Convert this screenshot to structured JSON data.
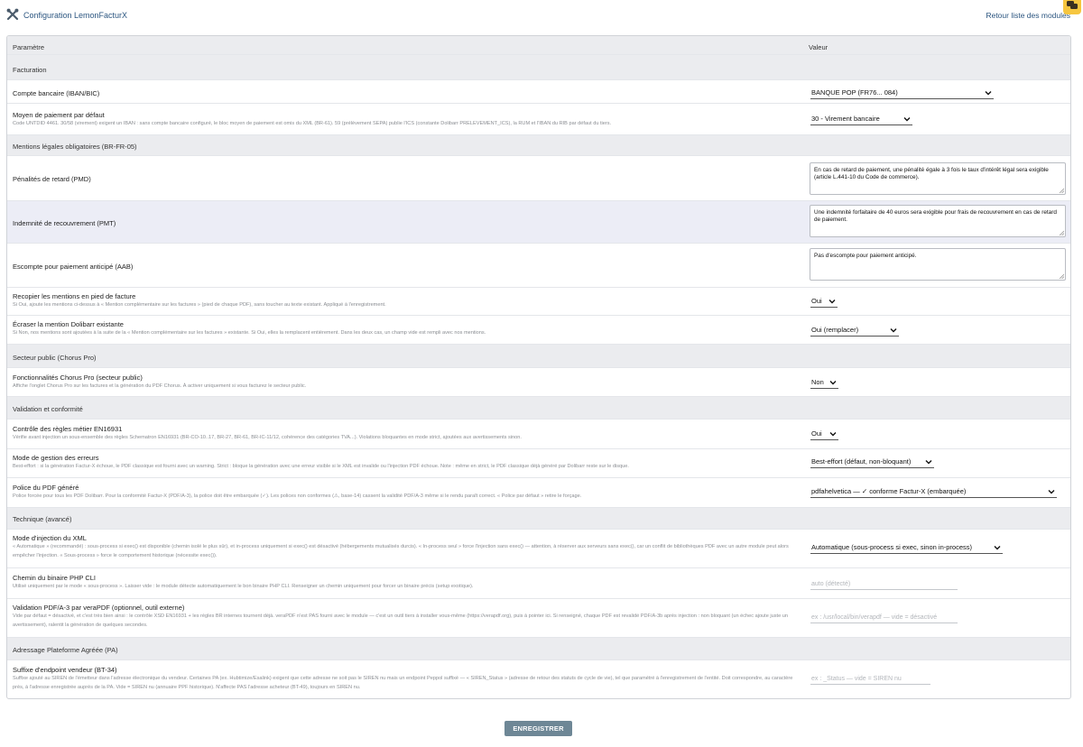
{
  "header": {
    "title": "Configuration LemonFacturX",
    "back_link": "Retour liste des modules",
    "title_icon": "tools-icon",
    "corner_icon": "chat-icon"
  },
  "table": {
    "col_param": "Paramètre",
    "col_value": "Valeur"
  },
  "sections": {
    "facturation": "Facturation",
    "mentions": "Mentions légales obligatoires (BR-FR-05)",
    "chorus": "Secteur public (Chorus Pro)",
    "validation": "Validation et conformité",
    "technique": "Technique (avancé)",
    "pa": "Adressage Plateforme Agréée (PA)"
  },
  "fields": {
    "bank": {
      "label": "Compte bancaire (IBAN/BIC)",
      "value": "BANQUE POP (FR76... 084)"
    },
    "payment": {
      "label": "Moyen de paiement par défaut",
      "desc": "Code UNTDID 4461. 30/58 (virement) exigent un IBAN : sans compte bancaire configuré, le bloc moyen de paiement est omis du XML (BR-61). 59 (prélèvement SEPA) publie l'ICS (constante Dolibarr PRELEVEMENT_ICS), la RUM et l'IBAN du RIB par défaut du tiers.",
      "value": "30 - Virement bancaire"
    },
    "pmd": {
      "label": "Pénalités de retard (PMD)",
      "value": "En cas de retard de paiement, une pénalité égale à 3 fois le taux d'intérêt légal sera exigible (article L.441-10 du Code de commerce)."
    },
    "pmt": {
      "label": "Indemnité de recouvrement (PMT)",
      "value": "Une indemnité forfaitaire de 40 euros sera exigible pour frais de recouvrement en cas de retard de paiement."
    },
    "aab": {
      "label": "Escompte pour paiement anticipé (AAB)",
      "value": "Pas d'escompte pour paiement anticipé."
    },
    "copy_mentions": {
      "label": "Recopier les mentions en pied de facture",
      "desc": "Si Oui, ajoute les mentions ci-dessus à « Mention complémentaire sur les factures » (pied de chaque PDF), sans toucher au texte existant. Appliqué à l'enregistrement.",
      "value": "Oui"
    },
    "overwrite": {
      "label": "Écraser la mention Dolibarr existante",
      "desc": "Si Non, nos mentions sont ajoutées à la suite de la « Mention complémentaire sur les factures » existante. Si Oui, elles la remplacent entièrement. Dans les deux cas, un champ vide est rempli avec nos mentions.",
      "value": "Oui (remplacer)"
    },
    "chorus": {
      "label": "Fonctionnalités Chorus Pro (secteur public)",
      "desc": "Affiche l'onglet Chorus Pro sur les factures et la génération du PDF Chorus. À activer uniquement si vous facturez le secteur public.",
      "value": "Non"
    },
    "en16931": {
      "label": "Contrôle des règles métier EN16931",
      "desc": "Vérifie avant injection un sous-ensemble des règles Schematron EN16931 (BR-CO-10..17, BR-27, BR-61, BR-IC-11/12, cohérence des catégories TVA...). Violations bloquantes en mode strict, ajoutées aux avertissements sinon.",
      "value": "Oui"
    },
    "errors": {
      "label": "Mode de gestion des erreurs",
      "desc": "Best-effort : si la génération Factur-X échoue, le PDF classique est fourni avec un warning. Strict : bloque la génération avec une erreur visible si le XML est invalide ou l'injection PDF échoue. Note : même en strict, le PDF classique déjà généré par Dolibarr reste sur le disque.",
      "value": "Best-effort (défaut, non-bloquant)"
    },
    "font": {
      "label": "Police du PDF généré",
      "desc": "Police forcée pour tous les PDF Dolibarr. Pour la conformité Factur-X (PDF/A-3), la police doit être embarquée (✓). Les polices non conformes (⚠, base-14) cassent la validité PDF/A-3 même si le rendu paraît correct. « Police par défaut » retire le forçage.",
      "value": "pdfahelvetica — ✓ conforme Factur-X (embarquée)"
    },
    "injection": {
      "label": "Mode d'injection du XML",
      "desc": "« Automatique » (recommandé) : sous-process si exec() est disponible (chemin isolé le plus sûr), et in-process uniquement si exec() est désactivé (hébergements mutualisés durcis). « In-process seul » force l'injection sans exec() — attention, à réserver aux serveurs sans exec(), car un conflit de bibliothèques PDF avec un autre module peut alors empêcher l'injection. « Sous-process » force le comportement historique (nécessite exec()).",
      "value": "Automatique (sous-process si exec, sinon in-process)"
    },
    "php": {
      "label": "Chemin du binaire PHP CLI",
      "desc": "Utilisé uniquement par le mode « sous-process ». Laisser vide : le module détecte automatiquement le bon binaire PHP CLI. Renseigner un chemin uniquement pour forcer un binaire précis (setup exotique).",
      "placeholder": "auto (détecté)"
    },
    "verapdf": {
      "label": "Validation PDF/A-3 par veraPDF (optionnel, outil externe)",
      "desc": "Vide par défaut = désactivé, et c'est très bien ainsi : le contrôle XSD EN16931 + les règles BR internes tournent déjà. veraPDF n'est PAS fourni avec le module — c'est un outil tiers à installer vous-même (https://verapdf.org), puis à pointer ici. Si renseigné, chaque PDF est revalidé PDF/A-3b après injection : non bloquant (un échec ajoute juste un avertissement), ralentit la génération de quelques secondes.",
      "placeholder": "ex : /usr/local/bin/verapdf — vide = désactivé"
    },
    "endpoint": {
      "label": "Suffixe d'endpoint vendeur (BT-34)",
      "desc": "Suffixe ajouté au SIREN de l'émetteur dans l'adresse électronique du vendeur. Certaines PA (ex. Hubtimize/Esalink) exigent que cette adresse ne soit pas le SIREN nu mais un endpoint Peppol suffixé — « SIREN_Status » (adresse de retour des statuts de cycle de vie), tel que paramétré à l'enregistrement de l'entité. Doit correspondre, au caractère près, à l'adresse enregistrée auprès de la PA. Vide = SIREN nu (annuaire PPF historique). N'affecte PAS l'adresse acheteur (BT-49), toujours en SIREN nu.",
      "placeholder": "ex : _Status — vide = SIREN nu"
    }
  },
  "actions": {
    "save": "ENREGISTRER"
  },
  "colors": {
    "link": "#2c5680",
    "save_button": "#6e8796",
    "section_bg": "#ebecef",
    "badge": "#f6c640"
  }
}
